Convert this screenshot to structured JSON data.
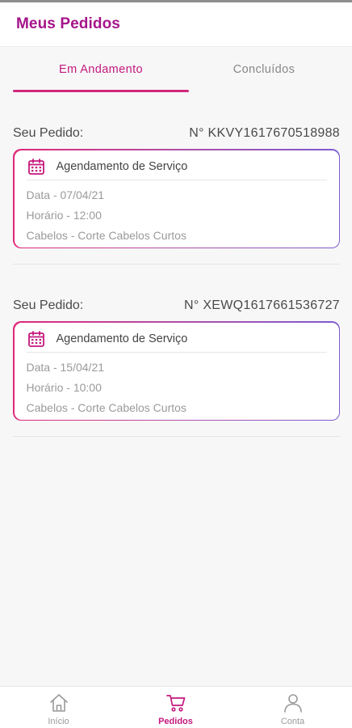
{
  "header": {
    "title": "Meus Pedidos"
  },
  "tabs": [
    {
      "label": "Em Andamento",
      "active": true
    },
    {
      "label": "Concluídos",
      "active": false
    }
  ],
  "orders": [
    {
      "label": "Seu Pedido:",
      "number": "N° KKVY1617670518988",
      "card_title": "Agendamento de Serviço",
      "date": "Data - 07/04/21",
      "time": "Horário - 12:00",
      "service": "Cabelos - Corte Cabelos Curtos",
      "icon": "calendar-icon"
    },
    {
      "label": "Seu Pedido:",
      "number": "N° XEWQ1617661536727",
      "card_title": "Agendamento de Serviço",
      "date": "Data - 15/04/21",
      "time": "Horário - 10:00",
      "service": "Cabelos - Corte Cabelos Curtos",
      "icon": "calendar-icon"
    }
  ],
  "bottom_nav": [
    {
      "label": "Início",
      "icon": "home-icon",
      "active": false
    },
    {
      "label": "Pedidos",
      "icon": "cart-icon",
      "active": true
    },
    {
      "label": "Conta",
      "icon": "user-icon",
      "active": false
    }
  ],
  "colors": {
    "brand": "#a6148a",
    "accent": "#c4187c",
    "gradient_start": "#e0287a",
    "gradient_end": "#7d5bd0"
  }
}
